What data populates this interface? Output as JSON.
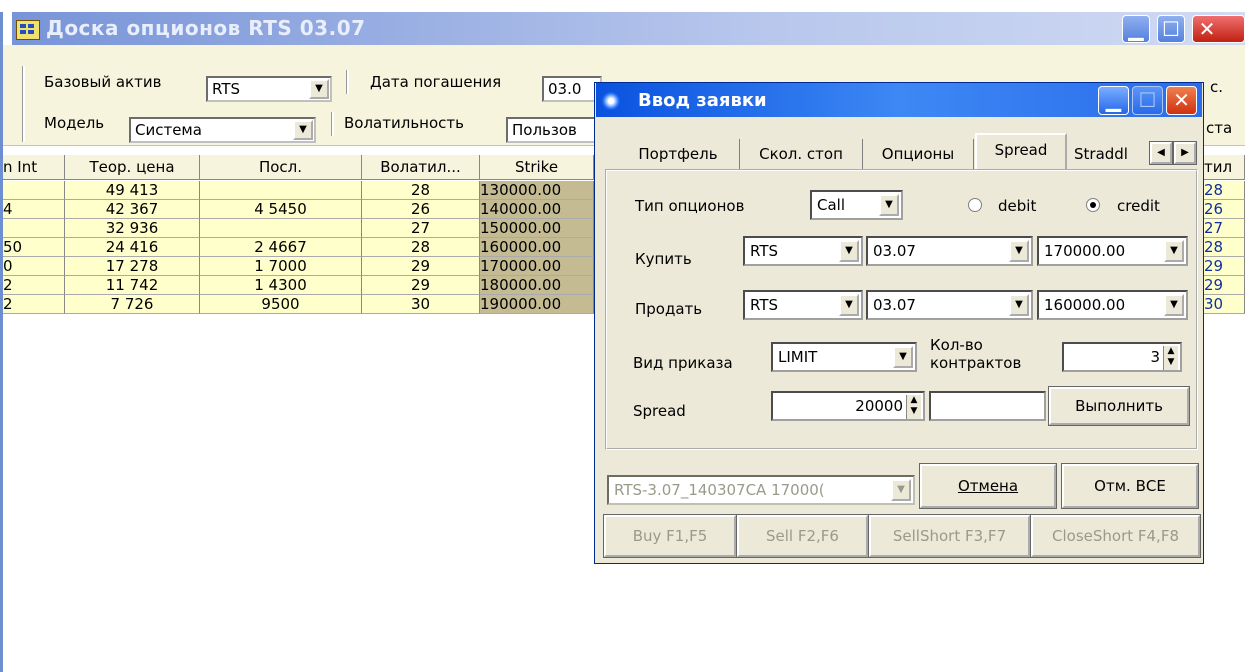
{
  "main_window": {
    "title": "Доска опционов RTS 03.07",
    "filters": {
      "base_asset_label": "Базовый актив",
      "base_asset_value": "RTS",
      "expiry_label": "Дата погашения",
      "expiry_value": "03.0",
      "model_label": "Модель",
      "model_value": "Система",
      "volatility_label": "Волатильность",
      "volatility_value": "Пользов",
      "right_label_1": "с.",
      "right_label_2": "ста"
    },
    "columns": [
      "n Int",
      "Теор. цена",
      "Посл.",
      "Волатил...",
      "Strike"
    ],
    "right_column": "тил",
    "rows": [
      {
        "int": "",
        "theor": "49 413",
        "last": "",
        "vol": "28",
        "strike": "130000.00",
        "rvol": "28"
      },
      {
        "int": "4",
        "theor": "42 367",
        "last": "4 5450",
        "vol": "26",
        "strike": "140000.00",
        "rvol": "26"
      },
      {
        "int": "",
        "theor": "32 936",
        "last": "",
        "vol": "27",
        "strike": "150000.00",
        "rvol": "27"
      },
      {
        "int": "50",
        "theor": "24 416",
        "last": "2 4667",
        "vol": "28",
        "strike": "160000.00",
        "rvol": "28"
      },
      {
        "int": "0",
        "theor": "17 278",
        "last": "1 7000",
        "vol": "29",
        "strike": "170000.00",
        "rvol": "29"
      },
      {
        "int": "2",
        "theor": "11 742",
        "last": "1 4300",
        "vol": "29",
        "strike": "180000.00",
        "rvol": "29"
      },
      {
        "int": "2",
        "theor": "7 726",
        "last": "9500",
        "vol": "30",
        "strike": "190000.00",
        "rvol": "30"
      }
    ]
  },
  "dialog": {
    "title": "Ввод заявки",
    "tabs": [
      "Портфель",
      "Скол. стоп",
      "Опционы",
      "Spread",
      "Straddl"
    ],
    "active_tab": "Spread",
    "option_type_label": "Тип опционов",
    "option_type_value": "Call",
    "radio_debit": "debit",
    "radio_credit": "credit",
    "selected_radio": "credit",
    "buy_label": "Купить",
    "buy": {
      "asset": "RTS",
      "expiry": "03.07",
      "strike": "170000.00"
    },
    "sell_label": "Продать",
    "sell": {
      "asset": "RTS",
      "expiry": "03.07",
      "strike": "160000.00"
    },
    "order_type_label": "Вид приказа",
    "order_type_value": "LIMIT",
    "contracts_label_1": "Кол-во",
    "contracts_label_2": "контрактов",
    "contracts_value": "3",
    "spread_label": "Spread",
    "spread_value": "20000",
    "execute_button": "Выполнить",
    "order_select_value": "RTS-3.07_140307CA 17000(",
    "cancel_button": "Отмена",
    "cancel_all_button": "Отм. ВСЕ",
    "buy_button": "Buy F1,F5",
    "sell_button": "Sell F2,F6",
    "sellshort_button": "SellShort F3,F7",
    "closeshort_button": "CloseShort F4,F8"
  }
}
